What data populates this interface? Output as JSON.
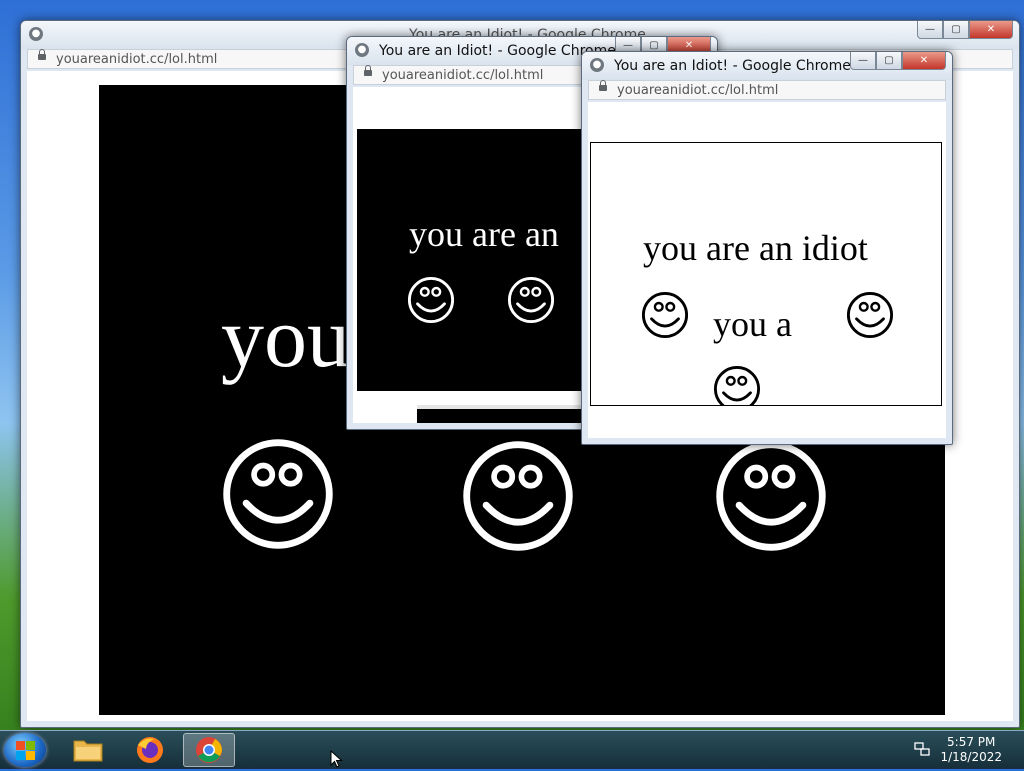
{
  "windows": [
    {
      "title": "You are an Idiot! - Google Chrome",
      "url": "youareanidiot.cc/lol.html",
      "text": "you",
      "theme": "black"
    },
    {
      "title": "You are an Idiot! - Google Chrome",
      "url": "youareanidiot.cc/lol.html",
      "text": "you are an",
      "theme": "black"
    },
    {
      "title": "You are an Idiot! - Google Chrome",
      "url": "youareanidiot.cc/lol.html",
      "text": "you are an idiot",
      "text2": "you a",
      "theme": "white"
    }
  ],
  "window_controls": {
    "minimize": "—",
    "maximize": "▢",
    "close": "✕"
  },
  "taskbar": {
    "items": [
      "file-explorer-icon",
      "firefox-icon",
      "chrome-icon"
    ],
    "time": "5:57 PM",
    "date": "1/18/2022"
  },
  "colors": {
    "black_bg": "#000000",
    "white_bg": "#ffffff",
    "close_red": "#c4362a"
  }
}
